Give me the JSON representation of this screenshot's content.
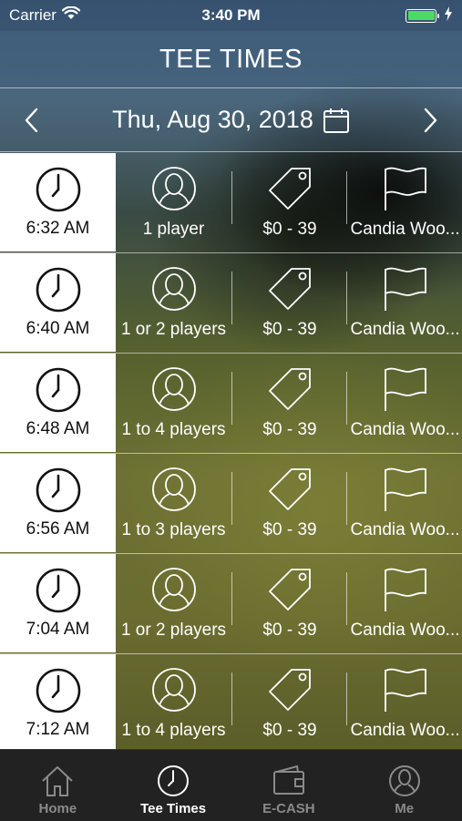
{
  "status_bar": {
    "carrier": "Carrier",
    "time": "3:40 PM",
    "battery_color": "#4cd964"
  },
  "header": {
    "title": "TEE TIMES"
  },
  "date_nav": {
    "date": "Thu, Aug 30, 2018"
  },
  "tee_times": [
    {
      "time": "6:32 AM",
      "players": "1 player",
      "price": "$0 - 39",
      "course": "Candia Woo..."
    },
    {
      "time": "6:40 AM",
      "players": "1 or 2 players",
      "price": "$0 - 39",
      "course": "Candia Woo..."
    },
    {
      "time": "6:48 AM",
      "players": "1 to 4 players",
      "price": "$0 - 39",
      "course": "Candia Woo..."
    },
    {
      "time": "6:56 AM",
      "players": "1 to 3 players",
      "price": "$0 - 39",
      "course": "Candia Woo..."
    },
    {
      "time": "7:04 AM",
      "players": "1 or 2 players",
      "price": "$0 - 39",
      "course": "Candia Woo..."
    },
    {
      "time": "7:12 AM",
      "players": "1 to 4 players",
      "price": "$0 - 39",
      "course": "Candia Woo..."
    }
  ],
  "tabs": [
    {
      "label": "Home",
      "icon": "home-icon"
    },
    {
      "label": "Tee Times",
      "icon": "clock-icon",
      "active": true
    },
    {
      "label": "E-CASH",
      "icon": "wallet-icon"
    },
    {
      "label": "Me",
      "icon": "user-icon"
    }
  ]
}
